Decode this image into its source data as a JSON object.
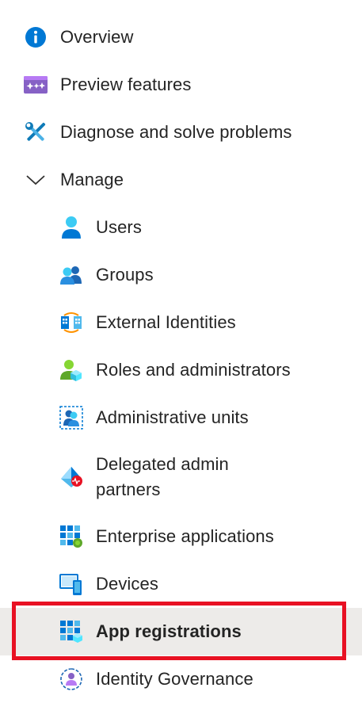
{
  "nav": {
    "overview": {
      "label": "Overview",
      "icon": "info-icon"
    },
    "preview_features": {
      "label": "Preview features",
      "icon": "preview-features-icon"
    },
    "diagnose": {
      "label": "Diagnose and solve problems",
      "icon": "wrench-screwdriver-icon"
    },
    "manage": {
      "label": "Manage",
      "icon": "chevron-down-icon",
      "expanded": true
    },
    "manage_items": [
      {
        "label": "Users",
        "icon": "user-icon"
      },
      {
        "label": "Groups",
        "icon": "groups-icon"
      },
      {
        "label": "External Identities",
        "icon": "external-identities-icon"
      },
      {
        "label": "Roles and administrators",
        "icon": "roles-icon"
      },
      {
        "label": "Administrative units",
        "icon": "administrative-units-icon"
      },
      {
        "label": "Delegated admin partners",
        "icon": "delegated-admin-icon"
      },
      {
        "label": "Enterprise applications",
        "icon": "enterprise-apps-icon"
      },
      {
        "label": "Devices",
        "icon": "devices-icon"
      },
      {
        "label": "App registrations",
        "icon": "app-registrations-icon",
        "selected": true
      },
      {
        "label": "Identity Governance",
        "icon": "identity-governance-icon"
      }
    ]
  },
  "colors": {
    "selected_background": "#edebe9",
    "highlight_border": "#e81123",
    "info_blue": "#0078d4",
    "preview_purple": "#8661c5"
  }
}
